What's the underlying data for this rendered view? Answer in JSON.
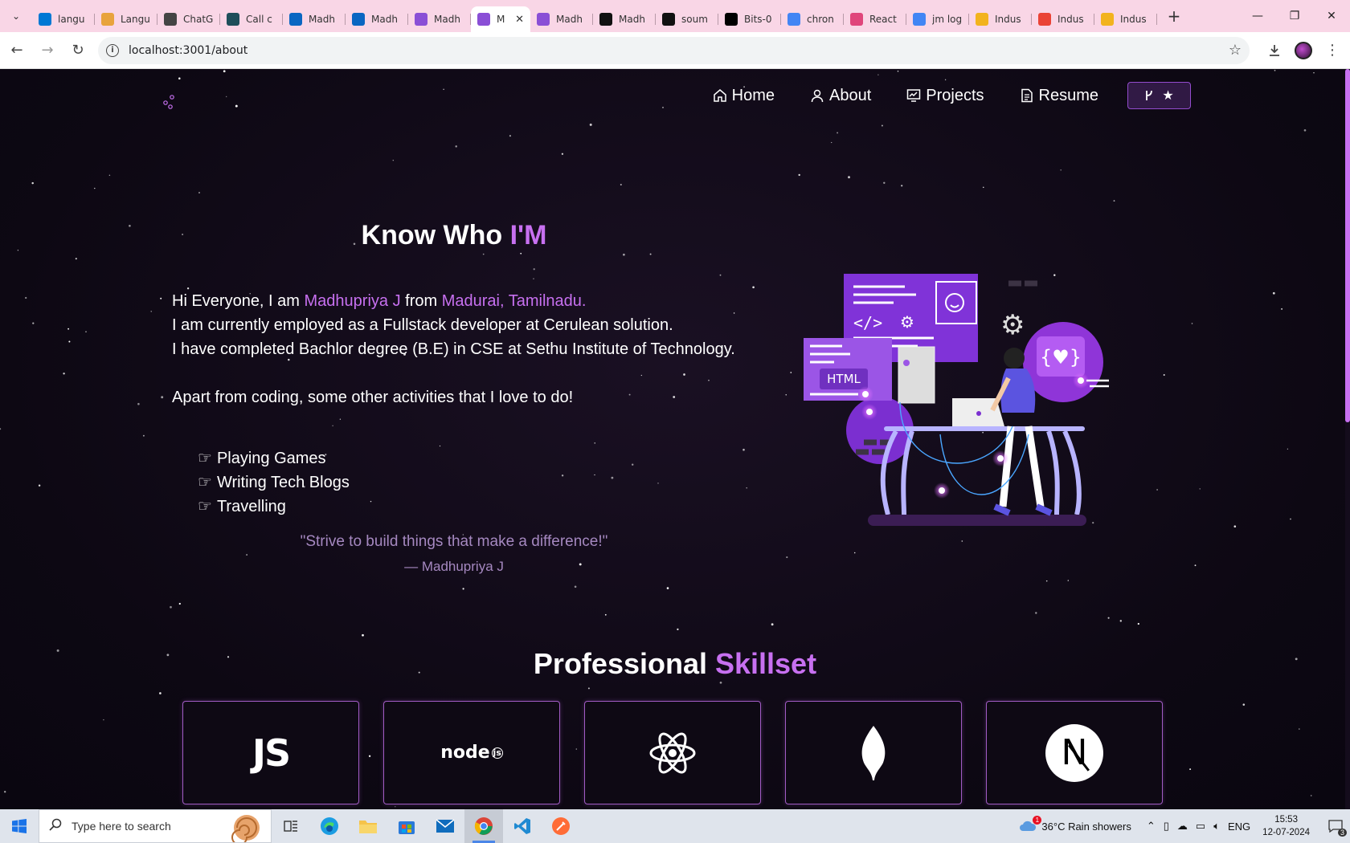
{
  "browser": {
    "tabs": [
      {
        "title": "langu",
        "icon": "azure-icon",
        "color": "#0078d4"
      },
      {
        "title": "Langu",
        "icon": "folder-icon",
        "color": "#e8a33d"
      },
      {
        "title": "ChatG",
        "icon": "chatgpt-icon",
        "color": "#444444"
      },
      {
        "title": "Call c",
        "icon": "app-icon",
        "color": "#1e4e5a"
      },
      {
        "title": "Madh",
        "icon": "linkedin-icon",
        "color": "#0a66c2"
      },
      {
        "title": "Madh",
        "icon": "linkedin-icon",
        "color": "#0a66c2"
      },
      {
        "title": "Madh",
        "icon": "portfolio-icon",
        "color": "#8a4fd6"
      },
      {
        "title": "M",
        "icon": "portfolio-icon",
        "color": "#8a4fd6"
      },
      {
        "title": "Madh",
        "icon": "portfolio-icon",
        "color": "#8a4fd6"
      },
      {
        "title": "Madh",
        "icon": "github-icon",
        "color": "#111111"
      },
      {
        "title": "soum",
        "icon": "github-icon",
        "color": "#111111"
      },
      {
        "title": "Bits-0",
        "icon": "vercel-icon",
        "color": "#000000"
      },
      {
        "title": "chron",
        "icon": "google-icon",
        "color": "#4285f4"
      },
      {
        "title": "React",
        "icon": "react-icon",
        "color": "#e0457b"
      },
      {
        "title": "jm log",
        "icon": "google-icon",
        "color": "#4285f4"
      },
      {
        "title": "Indus",
        "icon": "indus-icon",
        "color": "#f2b31e"
      },
      {
        "title": "Indus",
        "icon": "gmail-icon",
        "color": "#ea4335"
      },
      {
        "title": "Indus",
        "icon": "indus-icon",
        "color": "#f2b31e"
      }
    ],
    "active_tab_index": 7,
    "url": "localhost:3001/about"
  },
  "nav": {
    "home": "Home",
    "about": "About",
    "projects": "Projects",
    "resume": "Resume"
  },
  "about": {
    "heading_plain": "Know Who ",
    "heading_accent": "I'M",
    "line1_a": "Hi Everyone, I am ",
    "line1_name": "Madhupriya J",
    "line1_b": " from ",
    "line1_place": "Madurai, Tamilnadu.",
    "line2": "I am currently employed as a Fullstack developer at Cerulean solution.",
    "line3": "I have completed Bachlor degree (B.E) in CSE at Sethu Institute of Technology.",
    "line4": "Apart from coding, some other activities that I love to do!",
    "activities": [
      "Playing Games",
      "Writing Tech Blogs",
      "Travelling"
    ],
    "quote": "\"Strive to build things that make a difference!\"",
    "quote_author": "— Madhupriya J"
  },
  "skills": {
    "heading_plain": "Professional ",
    "heading_accent": "Skillset",
    "items": [
      {
        "name": "javascript-icon",
        "label": "JS"
      },
      {
        "name": "nodejs-icon",
        "label": "node"
      },
      {
        "name": "react-icon",
        "label": ""
      },
      {
        "name": "mongodb-icon",
        "label": ""
      },
      {
        "name": "nextjs-icon",
        "label": "N"
      }
    ]
  },
  "taskbar": {
    "search_placeholder": "Type here to search",
    "weather": "36°C  Rain showers",
    "weather_badge": "1",
    "language": "ENG",
    "time": "15:53",
    "date": "12-07-2024",
    "notification_count": "3"
  },
  "colors": {
    "accent": "#c770f0",
    "background": "#0c0812",
    "tab_strip": "#f9d6e6"
  }
}
